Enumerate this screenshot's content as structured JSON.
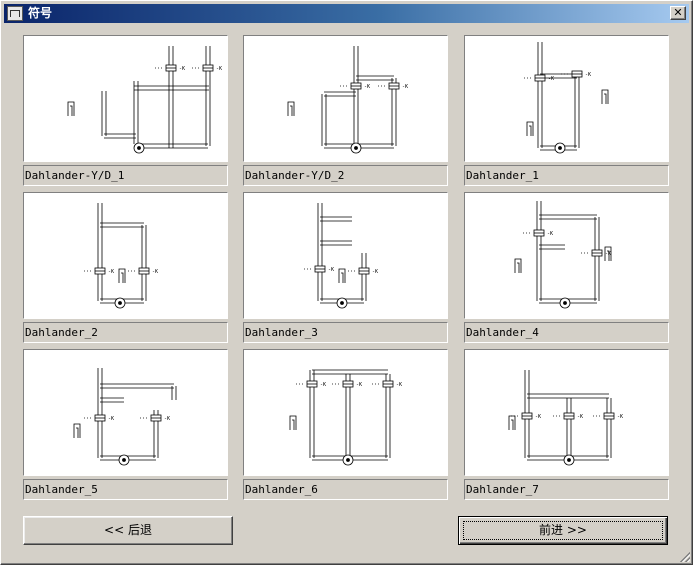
{
  "window": {
    "title": "符号",
    "icon": "app-icon",
    "close_icon": "close-icon",
    "close_glyph": "✕"
  },
  "symbols": [
    {
      "label": "Dahlander-Y/D_1",
      "icon": "circuit-diagram"
    },
    {
      "label": "Dahlander-Y/D_2",
      "icon": "circuit-diagram"
    },
    {
      "label": "Dahlander_1",
      "icon": "circuit-diagram"
    },
    {
      "label": "Dahlander_2",
      "icon": "circuit-diagram"
    },
    {
      "label": "Dahlander_3",
      "icon": "circuit-diagram"
    },
    {
      "label": "Dahlander_4",
      "icon": "circuit-diagram"
    },
    {
      "label": "Dahlander_5",
      "icon": "circuit-diagram"
    },
    {
      "label": "Dahlander_6",
      "icon": "circuit-diagram"
    },
    {
      "label": "Dahlander_7",
      "icon": "circuit-diagram"
    }
  ],
  "buttons": {
    "back_label": "<< 后退",
    "next_label": "前进 >>"
  }
}
